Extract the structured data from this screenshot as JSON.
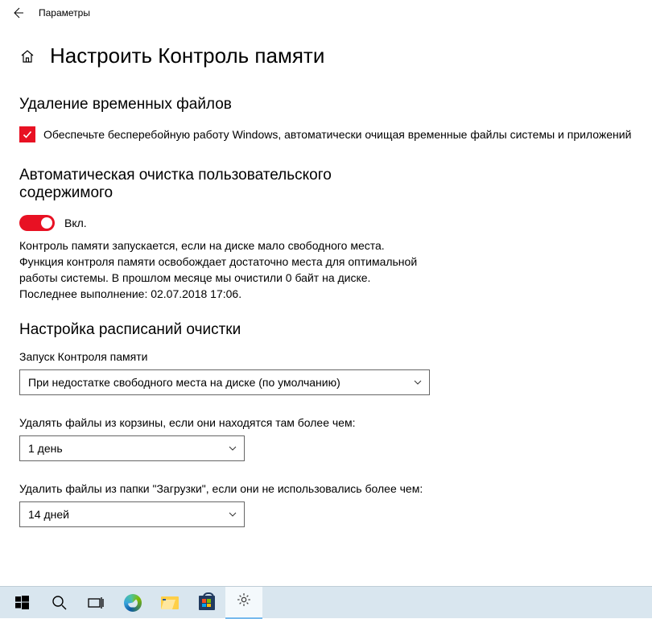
{
  "titlebar": {
    "title": "Параметры"
  },
  "page": {
    "title": "Настроить Контроль памяти"
  },
  "temp_files": {
    "heading": "Удаление временных файлов",
    "checkbox_label": "Обеспечьте бесперебойную работу Windows, автоматически очищая временные файлы системы и приложений"
  },
  "auto_clean": {
    "heading": "Автоматическая очистка пользовательского содержимого",
    "toggle_state": "Вкл.",
    "description": "Контроль памяти запускается, если на диске мало свободного места. Функция контроля памяти освобождает достаточно места для оптимальной работы системы. В прошлом месяце мы очистили 0 байт на диске. Последнее выполнение: 02.07.2018 17:06."
  },
  "schedule": {
    "heading": "Настройка расписаний очистки",
    "run_label": "Запуск Контроля памяти",
    "run_value": "При недостатке свободного места на диске (по умолчанию)",
    "recycle_label": "Удалять файлы из корзины, если они находятся там более чем:",
    "recycle_value": "1 день",
    "downloads_label": "Удалить файлы из папки \"Загрузки\", если они не использовались более чем:",
    "downloads_value": "14 дней"
  }
}
